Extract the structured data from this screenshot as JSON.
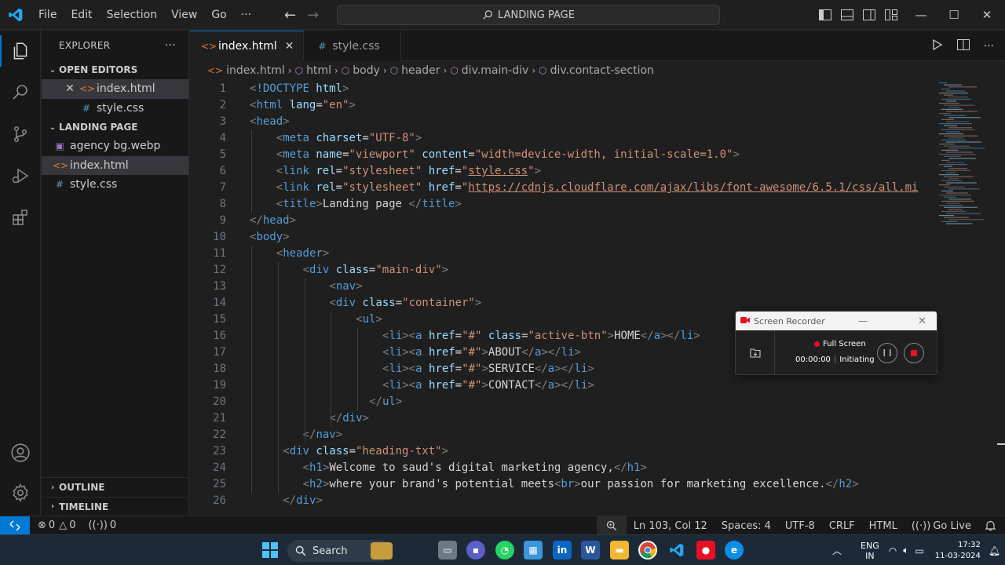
{
  "titlebar": {
    "menus": [
      "File",
      "Edit",
      "Selection",
      "View",
      "Go",
      "···"
    ],
    "command_center": "LANDING PAGE",
    "window_controls": {
      "minimize": "—",
      "maximize": "☐",
      "close": "✕"
    }
  },
  "explorer": {
    "title": "EXPLORER",
    "more": "···",
    "open_editors_label": "OPEN EDITORS",
    "open_editors": [
      {
        "name": "index.html",
        "type": "html"
      },
      {
        "name": "style.css",
        "type": "css"
      }
    ],
    "project_label": "LANDING PAGE",
    "files": [
      {
        "name": "agency bg.webp",
        "type": "image"
      },
      {
        "name": "index.html",
        "type": "html"
      },
      {
        "name": "style.css",
        "type": "css"
      }
    ],
    "outline_label": "OUTLINE",
    "timeline_label": "TIMELINE"
  },
  "tabs": [
    {
      "label": "index.html",
      "type": "html",
      "active": true
    },
    {
      "label": "style.css",
      "type": "css",
      "active": false
    }
  ],
  "breadcrumbs": [
    "index.html",
    "html",
    "body",
    "header",
    "div.main-div",
    "div.contact-section"
  ],
  "code": {
    "lines": [
      {
        "n": 1,
        "indent": 0,
        "tokens": [
          [
            "p",
            "<"
          ],
          [
            "t",
            "!DOCTYPE"
          ],
          [
            "a",
            " html"
          ],
          [
            "p",
            ">"
          ]
        ]
      },
      {
        "n": 2,
        "indent": 0,
        "tokens": [
          [
            "p",
            "<"
          ],
          [
            "t",
            "html"
          ],
          [
            "a",
            " lang"
          ],
          [
            "tx",
            "="
          ],
          [
            "s",
            "\"en\""
          ],
          [
            "p",
            ">"
          ]
        ]
      },
      {
        "n": 3,
        "indent": 0,
        "tokens": [
          [
            "p",
            "<"
          ],
          [
            "t",
            "head"
          ],
          [
            "p",
            ">"
          ]
        ]
      },
      {
        "n": 4,
        "indent": 1,
        "tokens": [
          [
            "p",
            "<"
          ],
          [
            "t",
            "meta"
          ],
          [
            "a",
            " charset"
          ],
          [
            "tx",
            "="
          ],
          [
            "s",
            "\"UTF-8\""
          ],
          [
            "p",
            ">"
          ]
        ]
      },
      {
        "n": 5,
        "indent": 1,
        "tokens": [
          [
            "p",
            "<"
          ],
          [
            "t",
            "meta"
          ],
          [
            "a",
            " name"
          ],
          [
            "tx",
            "="
          ],
          [
            "s",
            "\"viewport\""
          ],
          [
            "a",
            " content"
          ],
          [
            "tx",
            "="
          ],
          [
            "s",
            "\"width=device-width, initial-scale=1.0\""
          ],
          [
            "p",
            ">"
          ]
        ]
      },
      {
        "n": 6,
        "indent": 1,
        "tokens": [
          [
            "p",
            "<"
          ],
          [
            "t",
            "link"
          ],
          [
            "a",
            " rel"
          ],
          [
            "tx",
            "="
          ],
          [
            "s",
            "\"stylesheet\""
          ],
          [
            "a",
            " href"
          ],
          [
            "tx",
            "="
          ],
          [
            "s",
            "\""
          ],
          [
            "u",
            "style.css"
          ],
          [
            "s",
            "\""
          ],
          [
            "p",
            ">"
          ]
        ]
      },
      {
        "n": 7,
        "indent": 1,
        "tokens": [
          [
            "p",
            "<"
          ],
          [
            "t",
            "link"
          ],
          [
            "a",
            " rel"
          ],
          [
            "tx",
            "="
          ],
          [
            "s",
            "\"stylesheet\""
          ],
          [
            "a",
            " href"
          ],
          [
            "tx",
            "="
          ],
          [
            "s",
            "\""
          ],
          [
            "u",
            "https://cdnjs.cloudflare.com/ajax/libs/font-awesome/6.5.1/css/all.mi"
          ]
        ]
      },
      {
        "n": 8,
        "indent": 1,
        "tokens": [
          [
            "p",
            "<"
          ],
          [
            "t",
            "title"
          ],
          [
            "p",
            ">"
          ],
          [
            "tx",
            "Landing page "
          ],
          [
            "p",
            "</"
          ],
          [
            "t",
            "title"
          ],
          [
            "p",
            ">"
          ]
        ]
      },
      {
        "n": 9,
        "indent": 0,
        "tokens": [
          [
            "p",
            "</"
          ],
          [
            "t",
            "head"
          ],
          [
            "p",
            ">"
          ]
        ]
      },
      {
        "n": 10,
        "indent": 0,
        "tokens": [
          [
            "p",
            "<"
          ],
          [
            "t",
            "body"
          ],
          [
            "p",
            ">"
          ]
        ]
      },
      {
        "n": 11,
        "indent": 1,
        "tokens": [
          [
            "p",
            "<"
          ],
          [
            "t",
            "header"
          ],
          [
            "p",
            ">"
          ]
        ]
      },
      {
        "n": 12,
        "indent": 2,
        "tokens": [
          [
            "p",
            "<"
          ],
          [
            "t",
            "div"
          ],
          [
            "a",
            " class"
          ],
          [
            "tx",
            "="
          ],
          [
            "s",
            "\"main-div\""
          ],
          [
            "p",
            ">"
          ]
        ]
      },
      {
        "n": 13,
        "indent": 3,
        "tokens": [
          [
            "p",
            "<"
          ],
          [
            "t",
            "nav"
          ],
          [
            "p",
            ">"
          ]
        ]
      },
      {
        "n": 14,
        "indent": 3,
        "tokens": [
          [
            "p",
            "<"
          ],
          [
            "t",
            "div"
          ],
          [
            "a",
            " class"
          ],
          [
            "tx",
            "="
          ],
          [
            "s",
            "\"container\""
          ],
          [
            "p",
            ">"
          ]
        ]
      },
      {
        "n": 15,
        "indent": 4,
        "tokens": [
          [
            "p",
            "<"
          ],
          [
            "t",
            "ul"
          ],
          [
            "p",
            ">"
          ]
        ]
      },
      {
        "n": 16,
        "indent": 5,
        "tokens": [
          [
            "p",
            "<"
          ],
          [
            "t",
            "li"
          ],
          [
            "p",
            "><"
          ],
          [
            "t",
            "a"
          ],
          [
            "a",
            " href"
          ],
          [
            "tx",
            "="
          ],
          [
            "s",
            "\"#\""
          ],
          [
            "a",
            " class"
          ],
          [
            "tx",
            "="
          ],
          [
            "s",
            "\"active-btn\""
          ],
          [
            "p",
            ">"
          ],
          [
            "tx",
            "HOME"
          ],
          [
            "p",
            "</"
          ],
          [
            "t",
            "a"
          ],
          [
            "p",
            "></"
          ],
          [
            "t",
            "li"
          ],
          [
            "p",
            ">"
          ]
        ]
      },
      {
        "n": 17,
        "indent": 5,
        "tokens": [
          [
            "p",
            "<"
          ],
          [
            "t",
            "li"
          ],
          [
            "p",
            "><"
          ],
          [
            "t",
            "a"
          ],
          [
            "a",
            " href"
          ],
          [
            "tx",
            "="
          ],
          [
            "s",
            "\"#\""
          ],
          [
            "p",
            ">"
          ],
          [
            "tx",
            "ABOUT"
          ],
          [
            "p",
            "</"
          ],
          [
            "t",
            "a"
          ],
          [
            "p",
            "></"
          ],
          [
            "t",
            "li"
          ],
          [
            "p",
            ">"
          ]
        ]
      },
      {
        "n": 18,
        "indent": 5,
        "tokens": [
          [
            "p",
            "<"
          ],
          [
            "t",
            "li"
          ],
          [
            "p",
            "><"
          ],
          [
            "t",
            "a"
          ],
          [
            "a",
            " href"
          ],
          [
            "tx",
            "="
          ],
          [
            "s",
            "\"#\""
          ],
          [
            "p",
            ">"
          ],
          [
            "tx",
            "SERVICE"
          ],
          [
            "p",
            "</"
          ],
          [
            "t",
            "a"
          ],
          [
            "p",
            "></"
          ],
          [
            "t",
            "li"
          ],
          [
            "p",
            ">"
          ]
        ]
      },
      {
        "n": 19,
        "indent": 5,
        "tokens": [
          [
            "p",
            "<"
          ],
          [
            "t",
            "li"
          ],
          [
            "p",
            "><"
          ],
          [
            "t",
            "a"
          ],
          [
            "a",
            " href"
          ],
          [
            "tx",
            "="
          ],
          [
            "s",
            "\"#\""
          ],
          [
            "p",
            ">"
          ],
          [
            "tx",
            "CONTACT"
          ],
          [
            "p",
            "</"
          ],
          [
            "t",
            "a"
          ],
          [
            "p",
            "></"
          ],
          [
            "t",
            "li"
          ],
          [
            "p",
            ">"
          ]
        ]
      },
      {
        "n": 20,
        "indent": 4.5,
        "tokens": [
          [
            "p",
            "</"
          ],
          [
            "t",
            "ul"
          ],
          [
            "p",
            ">"
          ]
        ]
      },
      {
        "n": 21,
        "indent": 3,
        "tokens": [
          [
            "p",
            "</"
          ],
          [
            "t",
            "div"
          ],
          [
            "p",
            ">"
          ]
        ]
      },
      {
        "n": 22,
        "indent": 2,
        "tokens": [
          [
            "p",
            "</"
          ],
          [
            "t",
            "nav"
          ],
          [
            "p",
            ">"
          ]
        ]
      },
      {
        "n": 23,
        "indent": 1.25,
        "tokens": [
          [
            "p",
            "<"
          ],
          [
            "t",
            "div"
          ],
          [
            "a",
            " class"
          ],
          [
            "tx",
            "="
          ],
          [
            "s",
            "\"heading-txt\""
          ],
          [
            "p",
            ">"
          ]
        ]
      },
      {
        "n": 24,
        "indent": 2,
        "tokens": [
          [
            "p",
            "<"
          ],
          [
            "t",
            "h1"
          ],
          [
            "p",
            ">"
          ],
          [
            "tx",
            "Welcome to saud's digital marketing agency,"
          ],
          [
            "p",
            "</"
          ],
          [
            "t",
            "h1"
          ],
          [
            "p",
            ">"
          ]
        ]
      },
      {
        "n": 25,
        "indent": 2,
        "tokens": [
          [
            "p",
            "<"
          ],
          [
            "t",
            "h2"
          ],
          [
            "p",
            ">"
          ],
          [
            "tx",
            "where your brand's potential meets"
          ],
          [
            "p",
            "<"
          ],
          [
            "t",
            "br"
          ],
          [
            "p",
            ">"
          ],
          [
            "tx",
            "our passion for marketing excellence."
          ],
          [
            "p",
            "</"
          ],
          [
            "t",
            "h2"
          ],
          [
            "p",
            ">"
          ]
        ]
      },
      {
        "n": 26,
        "indent": 1.25,
        "tokens": [
          [
            "p",
            "</"
          ],
          [
            "t",
            "div"
          ],
          [
            "p",
            ">"
          ]
        ]
      }
    ]
  },
  "recorder": {
    "title": "Screen Recorder",
    "mode": "Full Screen",
    "time": "00:00:00",
    "status": "Initiating"
  },
  "statusbar": {
    "errors": "0",
    "warnings": "0",
    "ports": "0",
    "position": "Ln 103, Col 12",
    "spaces": "Spaces: 4",
    "encoding": "UTF-8",
    "eol": "CRLF",
    "language": "HTML",
    "golive": "Go Live"
  },
  "taskbar": {
    "search": "Search",
    "lang_top": "ENG",
    "lang_bottom": "IN",
    "time": "17:32",
    "date": "11-03-2024"
  },
  "colors": {
    "accent": "#0078d4",
    "tag": "#569cd6",
    "attr": "#9cdcfe",
    "string": "#ce9178",
    "text": "#d4d4d4"
  }
}
